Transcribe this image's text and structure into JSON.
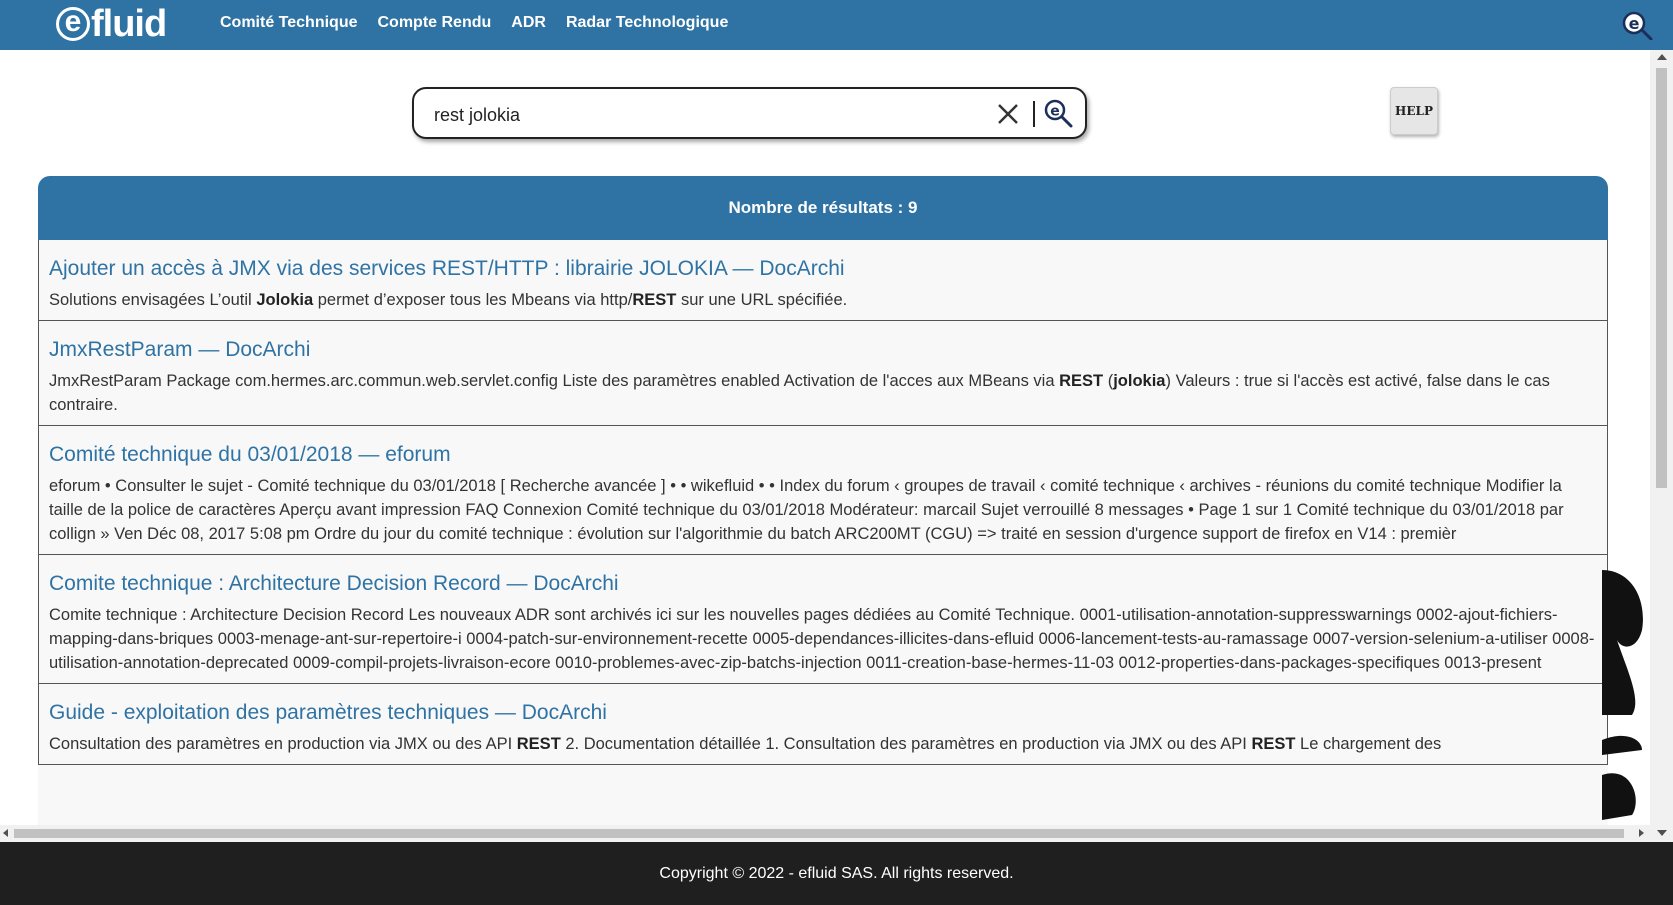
{
  "logo": {
    "mark": "e",
    "text": "fluid"
  },
  "nav": {
    "items": [
      {
        "label": "Comité Technique"
      },
      {
        "label": "Compte Rendu"
      },
      {
        "label": "ADR"
      },
      {
        "label": "Radar Technologique"
      }
    ]
  },
  "search": {
    "value": "rest jolokia",
    "clear_icon": "close-icon",
    "go_icon": "efluid-search-icon"
  },
  "help": {
    "label": "HELP"
  },
  "results": {
    "count_label": "Nombre de résultats : 9",
    "items": [
      {
        "title": "Ajouter un accès à JMX via des services REST/HTTP : librairie JOLOKIA — DocArchi",
        "snippet_parts": [
          {
            "t": "Solutions envisagées L’outil "
          },
          {
            "b": "Jolokia"
          },
          {
            "t": " permet d’exposer tous les Mbeans via http/"
          },
          {
            "b": "REST"
          },
          {
            "t": " sur une URL spécifiée."
          }
        ]
      },
      {
        "title": "JmxRestParam — DocArchi",
        "snippet_parts": [
          {
            "t": "JmxRestParam Package com.hermes.arc.commun.web.servlet.config Liste des paramètres enabled Activation de l'acces aux MBeans via "
          },
          {
            "b": "REST"
          },
          {
            "t": " ("
          },
          {
            "b": "jolokia"
          },
          {
            "t": ") Valeurs : true si l'accès est activé, false dans le cas contraire."
          }
        ]
      },
      {
        "title": "Comité technique du 03/01/2018 — eforum",
        "snippet_parts": [
          {
            "t": "eforum • Consulter le sujet - Comité technique du 03/01/2018 [ Recherche avancée ] • • wikefluid • • Index du forum ‹ groupes de travail ‹ comité technique ‹ archives - réunions du comité technique Modifier la taille de la police de caractères Aperçu avant impression FAQ Connexion Comité technique du 03/01/2018 Modérateur: marcail Sujet verrouillé 8 messages • Page 1 sur 1 Comité technique du 03/01/2018 par collign » Ven Déc 08, 2017 5:08 pm Ordre du jour du comité technique : évolution sur l'algorithmie du batch ARC200MT (CGU) => traité en session d'urgence support de firefox en V14 : premièr"
          }
        ]
      },
      {
        "title": "Comite technique : Architecture Decision Record — DocArchi",
        "snippet_parts": [
          {
            "t": "Comite technique : Architecture Decision Record Les nouveaux ADR sont archivés ici sur les nouvelles pages dédiées au Comité Technique. 0001-utilisation-annotation-suppresswarnings 0002-ajout-fichiers-mapping-dans-briques 0003-menage-ant-sur-repertoire-i 0004-patch-sur-environnement-recette 0005-dependances-illicites-dans-efluid 0006-lancement-tests-au-ramassage 0007-version-selenium-a-utiliser 0008-utilisation-annotation-deprecated 0009-compil-projets-livraison-ecore 0010-problemes-avec-zip-batchs-injection 0011-creation-base-hermes-11-03 0012-properties-dans-packages-specifiques 0013-present"
          }
        ]
      },
      {
        "title": "Guide - exploitation des paramètres techniques — DocArchi",
        "snippet_parts": [
          {
            "t": "Consultation des paramètres en production via JMX ou des API "
          },
          {
            "b": "REST"
          },
          {
            "t": " 2. Documentation détaillée 1. Consultation des paramètres en production via JMX ou des API "
          },
          {
            "b": "REST"
          },
          {
            "t": " Le chargement des"
          }
        ]
      }
    ]
  },
  "footer": {
    "copyright": "Copyright © 2022 - efluid SAS. All rights reserved."
  },
  "colors": {
    "brand": "#2f73a4",
    "footer_bg": "#1f1f1f",
    "link": "#2f73a4"
  }
}
